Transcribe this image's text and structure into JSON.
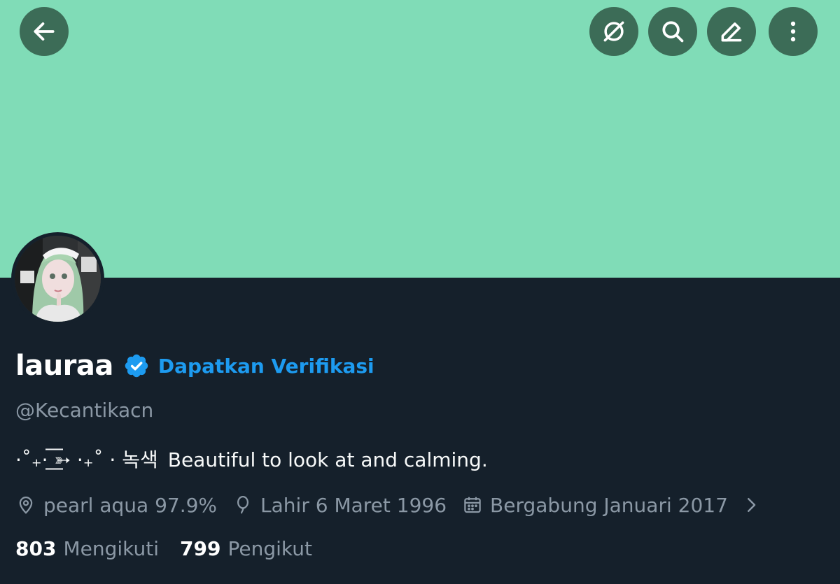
{
  "header": {
    "back_icon": "arrow-left-icon",
    "grok_icon": "grok-icon",
    "search_icon": "search-icon",
    "edit_icon": "edit-pencil-icon",
    "more_icon": "more-vertical-icon"
  },
  "colors": {
    "banner": "#80dcb7",
    "background": "#15202b",
    "header_button": "#3c6c57",
    "accent": "#1d9bf0",
    "secondary_text": "#8b98a5"
  },
  "profile": {
    "display_name": "lauraa",
    "verified_icon": "verified-badge-icon",
    "get_verified_label": "Dapatkan Verifikasi",
    "handle": "@Kecantikacn",
    "bio_decoration": "·˚₊· ͟͟͞͞➳ ·₊˚ · 녹색",
    "bio_text": "Beautiful to look at and calming.",
    "location": "pearl aqua 97.9%",
    "birthday": "Lahir 6 Maret 1996",
    "joined": "Bergabung Januari 2017",
    "following_count": "803",
    "following_label": "Mengikuti",
    "followers_count": "799",
    "followers_label": "Pengikut"
  }
}
